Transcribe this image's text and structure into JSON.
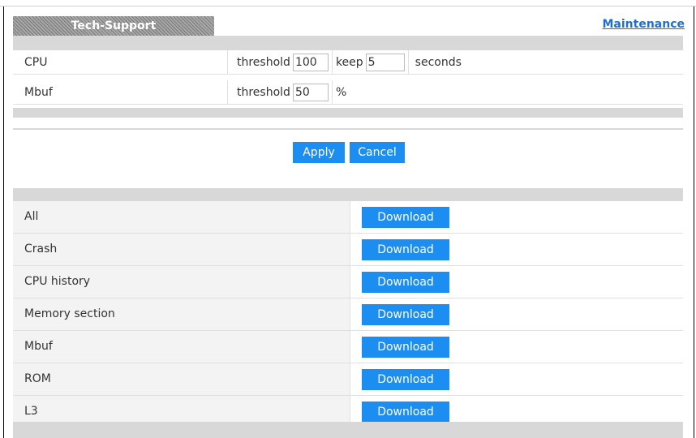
{
  "header": {
    "tab_title": "Tech-Support",
    "maintenance_link": "Maintenance"
  },
  "settings": {
    "cpu": {
      "label": "CPU",
      "threshold_label": "threshold",
      "threshold_value": "100",
      "keep_label": "keep",
      "keep_value": "5",
      "seconds_label": "seconds"
    },
    "mbuf": {
      "label": "Mbuf",
      "threshold_label": "threshold",
      "threshold_value": "50",
      "unit": "%"
    }
  },
  "actions": {
    "apply_label": "Apply",
    "cancel_label": "Cancel"
  },
  "downloads": {
    "button_label": "Download",
    "items": [
      "All",
      "Crash",
      "CPU history",
      "Memory section",
      "Mbuf",
      "ROM",
      "L3"
    ]
  },
  "colors": {
    "button_blue": "#1c8ef2",
    "link_blue": "#1f6fd0",
    "bar_grey": "#d8d8d8"
  }
}
